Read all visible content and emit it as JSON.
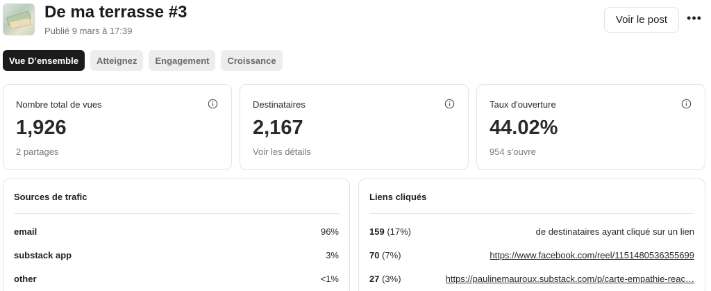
{
  "header": {
    "title": "De ma terrasse #3",
    "subtitle": "Publié 9 mars à 17:39",
    "view_button": "Voir le post",
    "more_label": "•••"
  },
  "tabs": [
    {
      "label": "Vue D’ensemble",
      "active": true
    },
    {
      "label": "Atteignez",
      "active": false
    },
    {
      "label": "Engagement",
      "active": false
    },
    {
      "label": "Croissance",
      "active": false
    }
  ],
  "stats": [
    {
      "label": "Nombre total de vues",
      "value": "1,926",
      "sub": "2 partages"
    },
    {
      "label": "Destinataires",
      "value": "2,167",
      "sub": "Voir les détails"
    },
    {
      "label": "Taux d'ouverture",
      "value": "44.02%",
      "sub": "954 s'ouvre"
    }
  ],
  "traffic": {
    "title": "Sources de trafic",
    "rows": [
      {
        "source": "email",
        "percent": "96%"
      },
      {
        "source": "substack app",
        "percent": "3%"
      },
      {
        "source": "other",
        "percent": "<1%"
      }
    ]
  },
  "links": {
    "title": "Liens cliqués",
    "rows": [
      {
        "count": "159",
        "percent": "(17%)",
        "target": "de destinataires ayant cliqué sur un lien",
        "is_link": false
      },
      {
        "count": "70",
        "percent": "(7%)",
        "target": "https://www.facebook.com/reel/1151480536355699",
        "is_link": true
      },
      {
        "count": "27",
        "percent": "(3%)",
        "target": "https://paulinemauroux.substack.com/p/carte-empathie-reac…",
        "is_link": true
      }
    ]
  },
  "colors": {
    "active_tab_bg": "#1c1c1c",
    "inactive_tab_bg": "#ededed",
    "card_border": "#e3e3e3"
  }
}
